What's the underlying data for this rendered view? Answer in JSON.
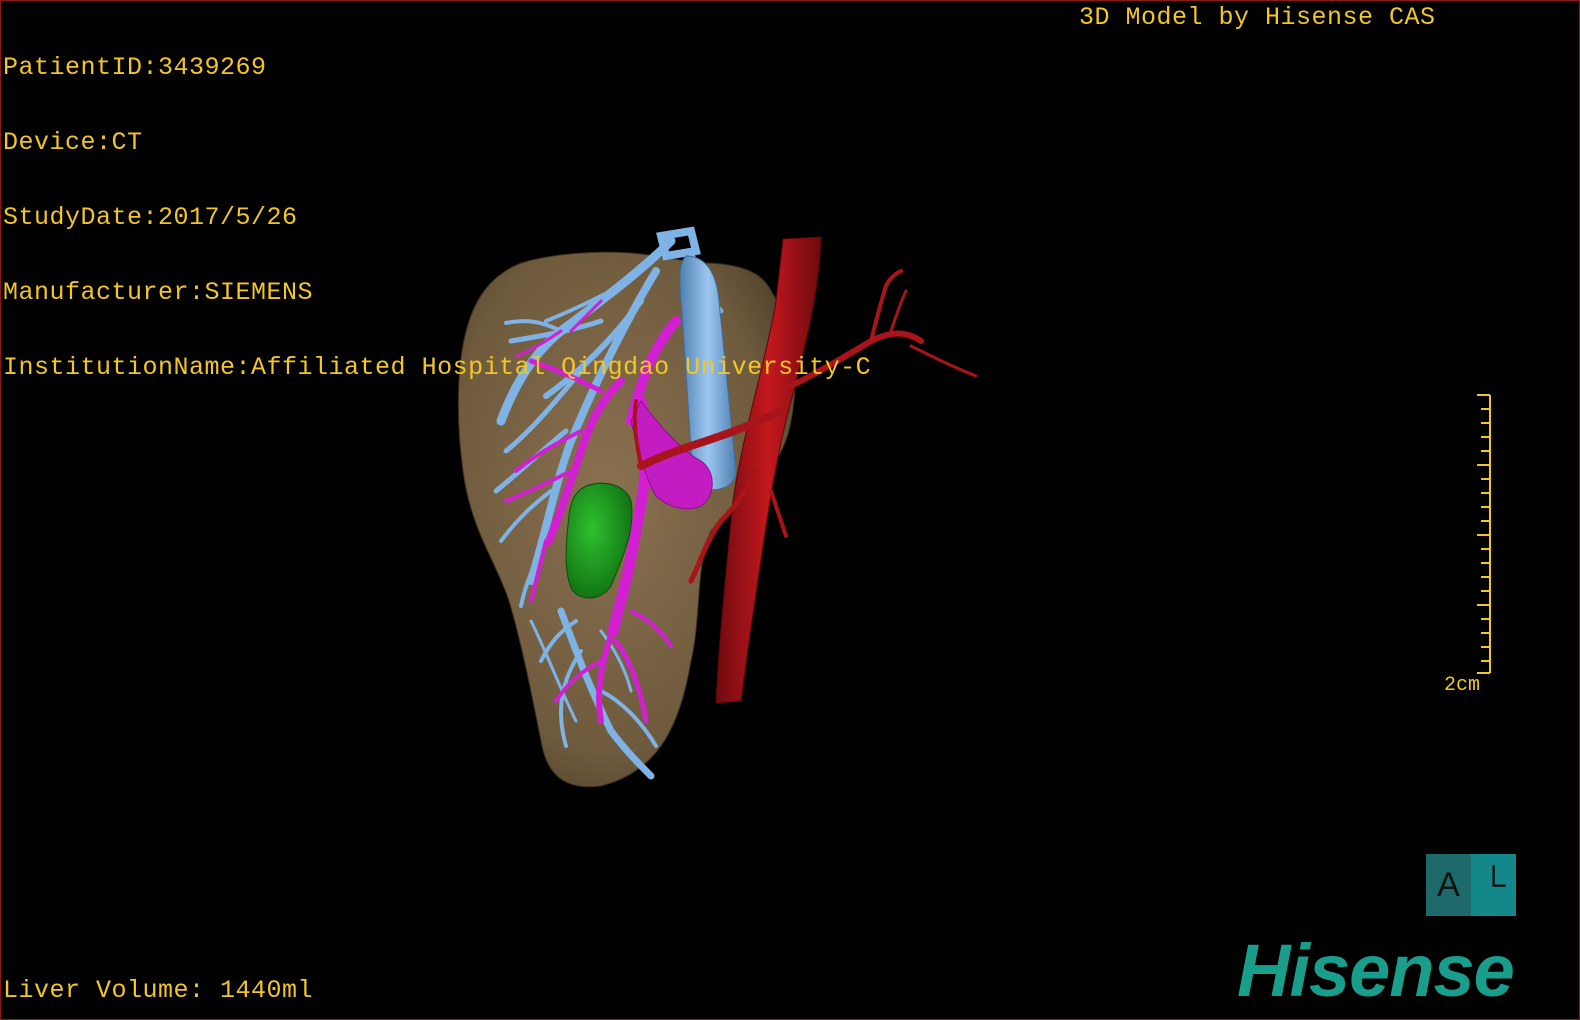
{
  "study_info": {
    "patient_id": "PatientID:3439269",
    "device": "Device:CT",
    "study_date": "StudyDate:2017/5/26",
    "manufacturer": "Manufacturer:SIEMENS",
    "institution": "InstitutionName:Affiliated Hospital Qingdao University-C"
  },
  "credit": "3D Model by Hisense CAS",
  "liver_volume": "Liver Volume: 1440ml",
  "scale": {
    "label": "2cm"
  },
  "orientation": {
    "front_label": "A",
    "side_label": "└"
  },
  "logo_text": "Hisense",
  "colors": {
    "overlay_text": "#f2c624",
    "liver": "#7a6445",
    "hepatic_vein": "#7fb2e5",
    "portal_vein": "#d21fd2",
    "artery": "#a8141a",
    "gallbladder": "#1f9a20",
    "logo": "#1a9e8c"
  }
}
